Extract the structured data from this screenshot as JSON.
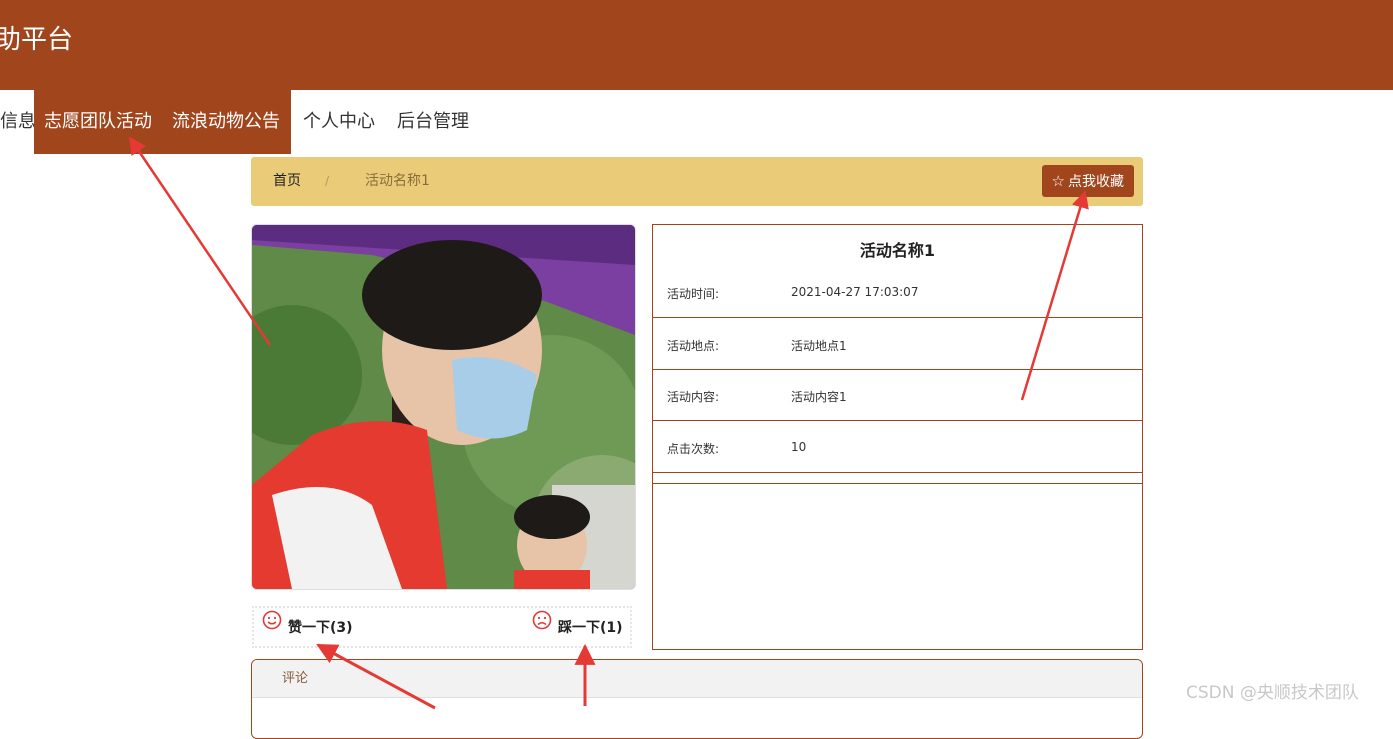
{
  "header": {
    "title": "助平台"
  },
  "nav": {
    "items": [
      {
        "label": "信息"
      },
      {
        "label": "志愿团队活动"
      },
      {
        "label": "流浪动物公告"
      },
      {
        "label": "个人中心"
      },
      {
        "label": "后台管理"
      }
    ]
  },
  "breadcrumb": {
    "home": "首页",
    "separator": "/",
    "current": "活动名称1"
  },
  "favorite": {
    "label": "点我收藏",
    "icon": "star-outline-icon"
  },
  "votes": {
    "like": {
      "label": "赞一下(3)",
      "icon": "smile-face-icon",
      "color": "#e53935"
    },
    "dislike": {
      "label": "踩一下(1)",
      "icon": "sad-face-icon",
      "color": "#e53935"
    }
  },
  "detail": {
    "title": "活动名称1",
    "rows": [
      {
        "label": "活动时间:",
        "value": "2021-04-27 17:03:07"
      },
      {
        "label": "活动地点:",
        "value": "活动地点1"
      },
      {
        "label": "活动内容:",
        "value": "活动内容1"
      },
      {
        "label": "点击次数:",
        "value": "10"
      }
    ]
  },
  "comments": {
    "title": "评论"
  },
  "watermark": {
    "text": "CSDN @央顺技术团队"
  },
  "colors": {
    "brand": "#a0451c",
    "breadcrumb_bg": "#e9cb78",
    "annotation_arrow": "#e53935"
  }
}
